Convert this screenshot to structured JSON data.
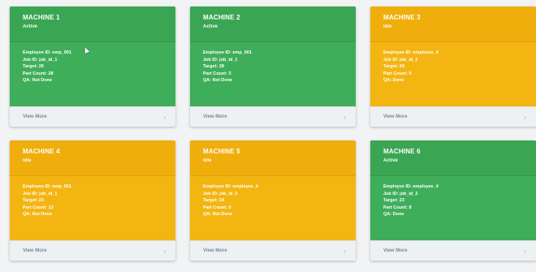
{
  "machines": [
    {
      "name": "MACHINE 1",
      "status": "Active",
      "employee": "Employee ID: emp_001",
      "job": "Job ID: job_id_1",
      "target": "Target: 26",
      "part_count": "Part Count: 28",
      "qa": "QA: Not Done",
      "view_more": "View More"
    },
    {
      "name": "MACHINE 2",
      "status": "Active",
      "employee": "Employee ID: emp_001",
      "job": "Job ID: job_id_1",
      "target": "Target: 28",
      "part_count": "Part Count: 3",
      "qa": "QA: Not Done",
      "view_more": "View More"
    },
    {
      "name": "MACHINE 3",
      "status": "Idle",
      "employee": "Employee ID: employee_4",
      "job": "Job ID: job_id_2",
      "target": "Target: 24",
      "part_count": "Part Count: 0",
      "qa": "QA: Done",
      "view_more": "View More"
    },
    {
      "name": "MACHINE 4",
      "status": "Idle",
      "employee": "Employee ID: emp_001",
      "job": "Job ID: job_id_1",
      "target": "Target: 23",
      "part_count": "Part Count: 13",
      "qa": "QA: Not Done",
      "view_more": "View More"
    },
    {
      "name": "MACHINE 5",
      "status": "Idle",
      "employee": "Employee ID: employee_4",
      "job": "Job ID: job_id_2",
      "target": "Target: 24",
      "part_count": "Part Count: 0",
      "qa": "QA: Not Done",
      "view_more": "View More"
    },
    {
      "name": "MACHINE 6",
      "status": "Active",
      "employee": "Employee ID: employee_4",
      "job": "Job ID: job_id_2",
      "target": "Target: 23",
      "part_count": "Part Count: 8",
      "qa": "QA: Done",
      "view_more": "View More"
    }
  ],
  "colors": {
    "active": "#3fae5a",
    "idle": "#f3b512",
    "footer": "#eef1f3"
  },
  "icons": {
    "footer_arrow": "chevron-right-icon"
  }
}
